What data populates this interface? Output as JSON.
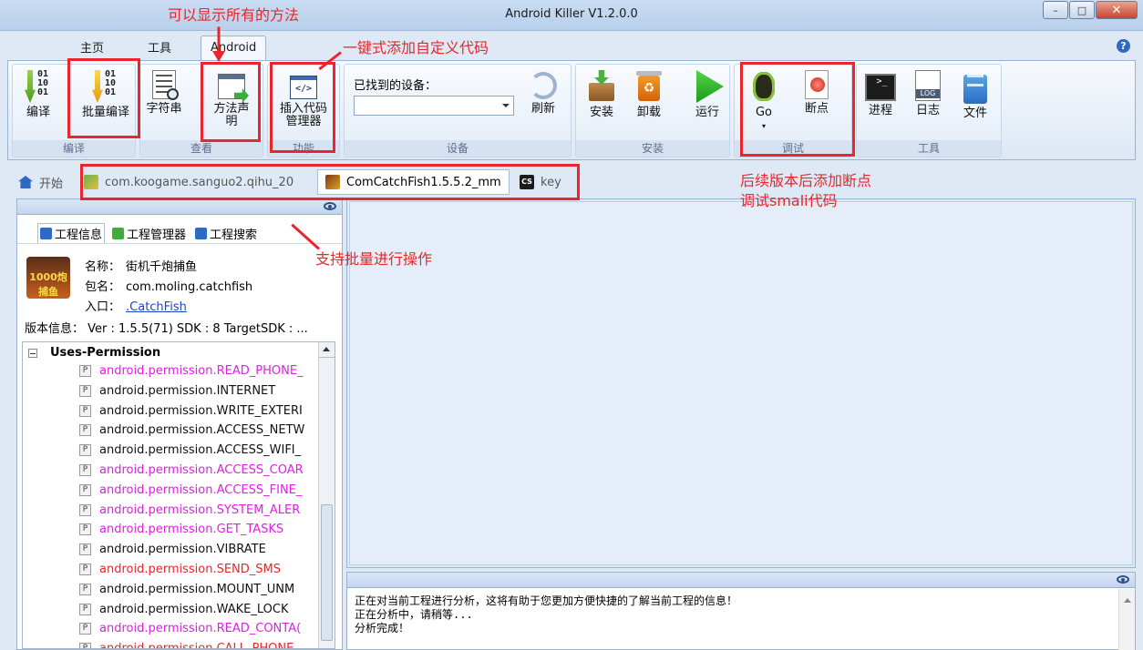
{
  "window": {
    "title": "Android Killer V1.2.0.0"
  },
  "ribbon_tabs": [
    "主页",
    "工具",
    "Android"
  ],
  "groups": {
    "compile": {
      "label": "编译",
      "buttons": [
        "编译",
        "批量编译"
      ]
    },
    "view": {
      "label": "查看",
      "buttons": [
        "字符串",
        "方法声明"
      ]
    },
    "function": {
      "label": "功能",
      "buttons": [
        "插入代码管理器"
      ]
    },
    "device": {
      "label": "设备",
      "found_label": "已找到的设备：",
      "refresh": "刷新"
    },
    "install": {
      "label": "安装",
      "buttons": [
        "安装",
        "卸载",
        "运行"
      ]
    },
    "debug": {
      "label": "调试",
      "buttons": [
        "Go",
        "断点"
      ]
    },
    "tools": {
      "label": "工具",
      "buttons": [
        "进程",
        "日志",
        "文件"
      ]
    }
  },
  "icons": {
    "log_badge": "LOG",
    "insert_code_glyph": "</>",
    "prompt_glyph": ">_"
  },
  "doc_tabs": [
    "开始",
    "com.koogame.sanguo2.qihu_20",
    "ComCatchFish1.5.5.2_mm",
    "key"
  ],
  "subtabs": [
    "工程信息",
    "工程管理器",
    "工程搜索"
  ],
  "project": {
    "icon_text": "1000炮捕鱼",
    "name_label": "名称：",
    "name": "街机千炮捕鱼",
    "package_label": "包名：",
    "package": "com.moling.catchfish",
    "entry_label": "入口：",
    "entry": ".CatchFish",
    "version_label": "版本信息：",
    "version": "Ver : 1.5.5(71) SDK : 8 TargetSDK : ..."
  },
  "permissions": {
    "root": "Uses-Permission",
    "items": [
      {
        "text": "android.permission.READ_PHONE_",
        "color": "#e020e0"
      },
      {
        "text": "android.permission.INTERNET",
        "color": "#111111"
      },
      {
        "text": "android.permission.WRITE_EXTERI",
        "color": "#111111"
      },
      {
        "text": "android.permission.ACCESS_NETW",
        "color": "#111111"
      },
      {
        "text": "android.permission.ACCESS_WIFI_",
        "color": "#111111"
      },
      {
        "text": "android.permission.ACCESS_COAR",
        "color": "#e020e0"
      },
      {
        "text": "android.permission.ACCESS_FINE_",
        "color": "#e020e0"
      },
      {
        "text": "android.permission.SYSTEM_ALER",
        "color": "#e020e0"
      },
      {
        "text": "android.permission.GET_TASKS",
        "color": "#e020e0"
      },
      {
        "text": "android.permission.VIBRATE",
        "color": "#111111"
      },
      {
        "text": "android.permission.SEND_SMS",
        "color": "#e8262b"
      },
      {
        "text": "android.permission.MOUNT_UNM",
        "color": "#111111"
      },
      {
        "text": "android.permission.WAKE_LOCK",
        "color": "#111111"
      },
      {
        "text": "android.permission.READ_CONTA(",
        "color": "#e020e0"
      },
      {
        "text": "android.permission.CALL_PHONE",
        "color": "#e8262b"
      }
    ]
  },
  "output": [
    "正在对当前工程进行分析，这将有助于您更加方便快捷的了解当前工程的信息！",
    "正在分析中，请稍等...",
    "分析完成！"
  ],
  "annotations": {
    "show_methods": "可以显示所有的方法",
    "insert_code": "一键式添加自定义代码",
    "batch_ops": "支持批量进行操作",
    "breakpoint_line1": "后续版本后添加断点",
    "breakpoint_line2": "调试smali代码"
  },
  "accent": "#e8262b"
}
